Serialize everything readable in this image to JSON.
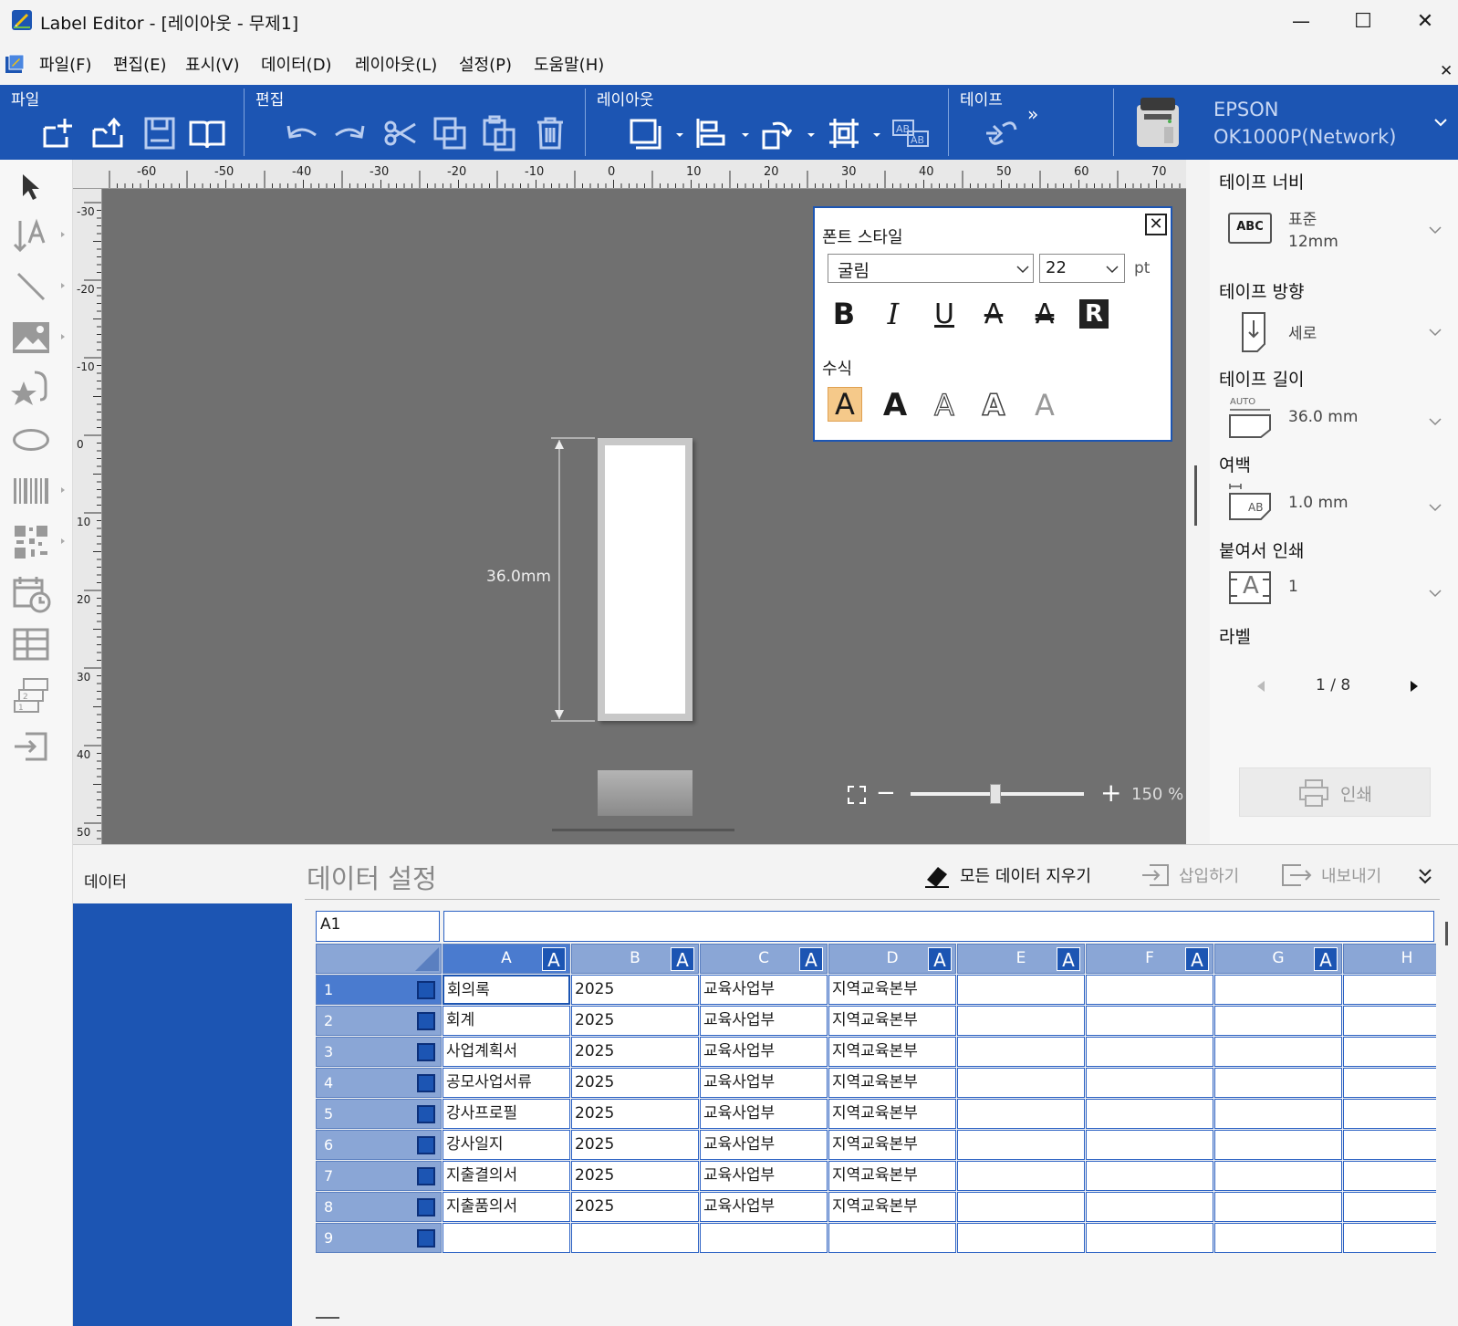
{
  "window": {
    "title": "Label Editor - [레이아웃  - 무제1]",
    "minimize": "—",
    "maximize": "☐",
    "close": "✕"
  },
  "menu": {
    "items": [
      "파일(F)",
      "편집(E)",
      "표시(V)",
      "데이터(D)",
      "레이아웃(L)",
      "설정(P)",
      "도움말(H)"
    ],
    "close": "✕"
  },
  "ribbon": {
    "groups": [
      "파일",
      "편집",
      "레이아웃",
      "테이프"
    ],
    "more": "»",
    "printer": {
      "brand": "EPSON",
      "model": "OK1000P(Network)"
    }
  },
  "ruler": {
    "h_labels": [
      "-60",
      "-50",
      "-40",
      "-30",
      "-20",
      "-10",
      "0",
      "10",
      "20",
      "30",
      "40",
      "50",
      "60",
      "70"
    ],
    "v_labels": [
      "-30",
      "-20",
      "-10",
      "0",
      "10",
      "20",
      "30",
      "40",
      "50"
    ]
  },
  "label": {
    "dimension": "36.0mm"
  },
  "font_panel": {
    "title": "폰트 스타일",
    "font": "굴림",
    "size": "22",
    "unit": "pt",
    "effects_label": "수식",
    "bold": "B",
    "italic": "I",
    "underline": "U",
    "strike": "A",
    "double_strike": "A",
    "reverse": "R",
    "effect_glyph": "A",
    "close": "✕"
  },
  "zoom": {
    "minus": "−",
    "plus": "+",
    "value": "150 %",
    "level": 0.49
  },
  "right_panel": {
    "tape_width": {
      "label": "테이프 너비",
      "line1": "표준",
      "line2": "12mm",
      "icon_text": "ABC"
    },
    "tape_direction": {
      "label": "테이프 방향",
      "value": "세로"
    },
    "tape_length": {
      "label": "테이프 길이",
      "value": "36.0 mm",
      "icon_text": "AUTO"
    },
    "margin": {
      "label": "여백",
      "value": "1.0 mm",
      "icon_text": "AB"
    },
    "attach_print": {
      "label": "붙여서 인쇄",
      "value": "1",
      "icon_text": "A"
    },
    "label_nav": {
      "label": "라벨",
      "value": "1 / 8"
    },
    "print": "인쇄"
  },
  "data": {
    "left_tab": "데이터",
    "title": "데이터 설정",
    "clear_all": "모든 데이터 지우기",
    "insert": "삽입하기",
    "export": "내보내기",
    "cell_ref": "A1",
    "formula": "",
    "columns": [
      "A",
      "B",
      "C",
      "D",
      "E",
      "F",
      "G",
      "H"
    ],
    "badge": "A",
    "rows": [
      {
        "num": "1",
        "cells": [
          "회의록",
          "2025",
          "교육사업부",
          "지역교육본부"
        ]
      },
      {
        "num": "2",
        "cells": [
          "회계",
          "2025",
          "교육사업부",
          "지역교육본부"
        ]
      },
      {
        "num": "3",
        "cells": [
          "사업계획서",
          "2025",
          "교육사업부",
          "지역교육본부"
        ]
      },
      {
        "num": "4",
        "cells": [
          "공모사업서류",
          "2025",
          "교육사업부",
          "지역교육본부"
        ]
      },
      {
        "num": "5",
        "cells": [
          "강사프로필",
          "2025",
          "교육사업부",
          "지역교육본부"
        ]
      },
      {
        "num": "6",
        "cells": [
          "강사일지",
          "2025",
          "교육사업부",
          "지역교육본부"
        ]
      },
      {
        "num": "7",
        "cells": [
          "지출결의서",
          "2025",
          "교육사업부",
          "지역교육본부"
        ]
      },
      {
        "num": "8",
        "cells": [
          "지출품의서",
          "2025",
          "교육사업부",
          "지역교육본부"
        ]
      },
      {
        "num": "9",
        "cells": [
          "",
          "",
          "",
          ""
        ]
      }
    ]
  },
  "colors": {
    "accent": "#1c55b3",
    "canvas": "#707070",
    "header": "#8aa6d6",
    "highlight": "#f5c98a"
  }
}
